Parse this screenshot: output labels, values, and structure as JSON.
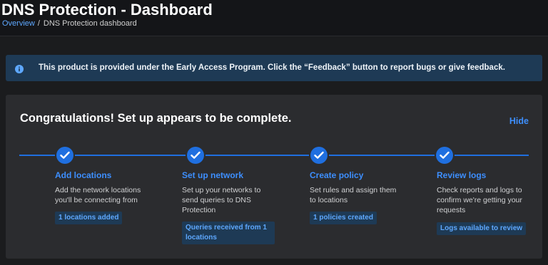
{
  "header": {
    "title": "DNS Protection - Dashboard",
    "breadcrumb": {
      "link": "Overview",
      "separator": "/",
      "current": "DNS Protection dashboard"
    }
  },
  "banner": {
    "icon": "info-icon",
    "text": "This product is provided under the Early Access Program. Click the “Feedback” button to report bugs or give feedback."
  },
  "card": {
    "title": "Congratulations! Set up appears to be complete.",
    "hide_label": "Hide",
    "steps": [
      {
        "title": "Add locations",
        "desc": "Add the network locations you'll be connecting from",
        "badge": "1 locations added",
        "status": "complete"
      },
      {
        "title": "Set up network",
        "desc": "Set up your networks to send queries to DNS Protection",
        "badge": "Queries received from 1 locations",
        "status": "complete"
      },
      {
        "title": "Create policy",
        "desc": "Set rules and assign them to locations",
        "badge": "1 policies created",
        "status": "complete"
      },
      {
        "title": "Review logs",
        "desc": "Check reports and logs to confirm we're getting your requests",
        "badge": "Logs available to review",
        "status": "complete"
      }
    ]
  },
  "colors": {
    "accent": "#1f6fe0",
    "link": "#3d8fff",
    "banner_bg": "#1e3a55",
    "card_bg": "#2b2c2f",
    "page_bg": "#1b1c1e"
  }
}
